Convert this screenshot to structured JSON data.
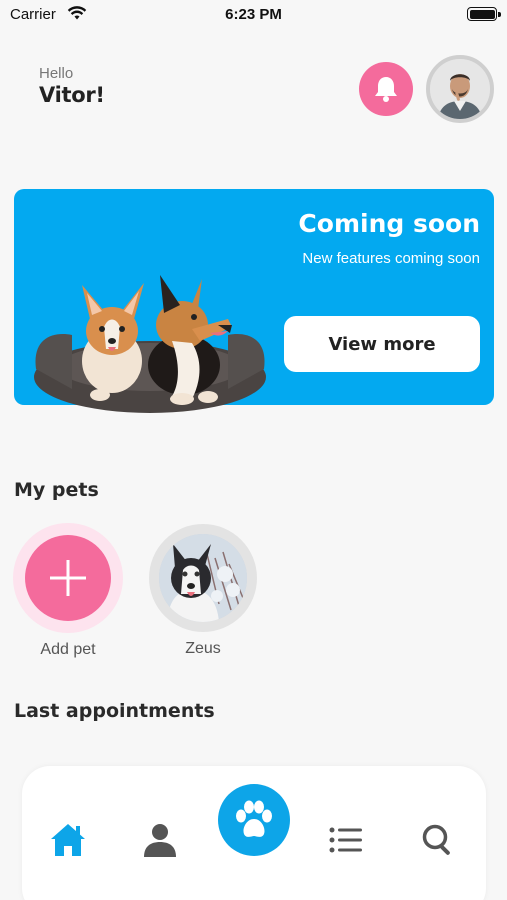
{
  "status_bar": {
    "carrier": "Carrier",
    "time": "6:23 PM",
    "icons": [
      "wifi-icon",
      "battery-icon"
    ]
  },
  "header": {
    "greeting": "Hello",
    "user_name": "Vitor!",
    "notification_icon": "bell-icon",
    "accent_color": "#f46b9c"
  },
  "banner": {
    "title": "Coming soon",
    "subtitle": "New features coming soon",
    "button_label": "View more",
    "background_color": "#03a9f0"
  },
  "pets": {
    "section_title": "My pets",
    "items": [
      {
        "label": "Add pet",
        "icon": "plus-icon"
      },
      {
        "label": "Zeus",
        "icon": "husky-photo"
      }
    ]
  },
  "appointments": {
    "section_title": "Last appointments"
  },
  "bottom_nav": {
    "items": [
      {
        "icon": "home-icon",
        "active": true
      },
      {
        "icon": "user-icon",
        "active": false
      },
      {
        "icon": "paw-icon",
        "active": false
      },
      {
        "icon": "list-icon",
        "active": false
      },
      {
        "icon": "search-icon",
        "active": false
      }
    ],
    "active_color": "#0da5e8",
    "inactive_color": "#555555"
  }
}
